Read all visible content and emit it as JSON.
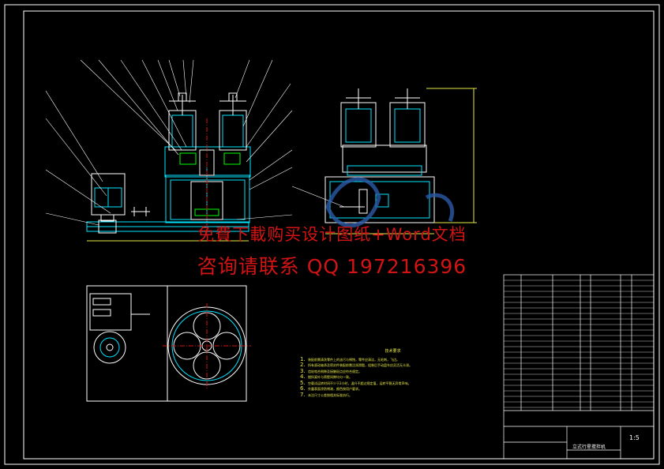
{
  "watermark": {
    "line1": "免費下載购买设计图纸+Word文档",
    "line2": "咨询请联系 QQ 197216396"
  },
  "colors": {
    "background": "#000000",
    "border": "#ffffff",
    "main_lines": "#00e5ff",
    "outline": "#ffffff",
    "leaders": "#ffffff",
    "watermark": "#d21414",
    "notes": "#e8e84a",
    "green_part": "#00ff00",
    "dim_lines": "#e8e84a"
  },
  "title_block": {
    "drawing_title": "立式行星搅拌机",
    "scale": "1:5"
  },
  "notes_block": {
    "title": "技术要求",
    "items": [
      {
        "num": "1.",
        "text": "装配前需清洗零件上的油污与锈蚀，零件应清洁，无毛刺，飞边。"
      },
      {
        "num": "2.",
        "text": "所有滚动轴承及密封件装配前需注润滑脂，组装后手动盘车应灵活无卡滞。"
      },
      {
        "num": "3.",
        "text": "齿轮啮合侧隙及接触斑点应符合规定。"
      },
      {
        "num": "4.",
        "text": "搅拌桨叶与筒壁间隙均匀一致。"
      },
      {
        "num": "5.",
        "text": "空载试运转时间不少于2小时，温升不超过规定值，运转平稳无异常声响。"
      },
      {
        "num": "6.",
        "text": "外露表面涂防锈漆，颜色按用户要求。"
      },
      {
        "num": "7.",
        "text": "未注尺寸公差按相关标准执行。"
      }
    ]
  }
}
